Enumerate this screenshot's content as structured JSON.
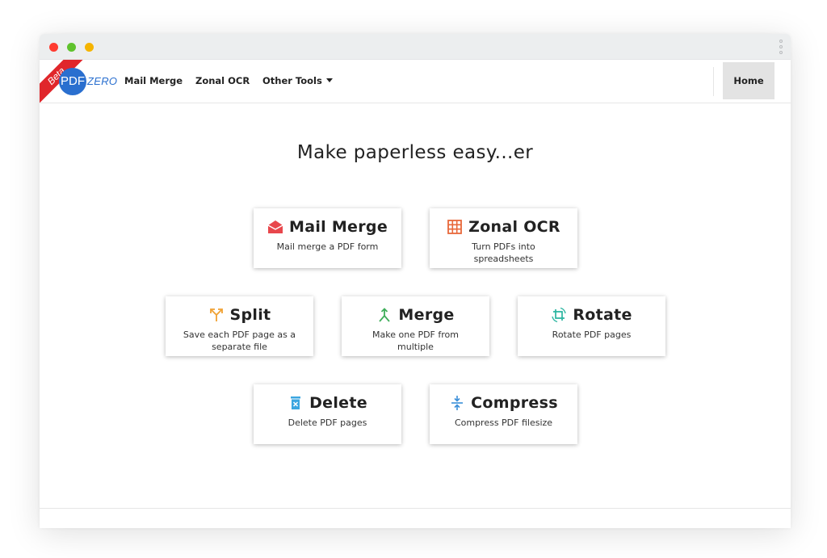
{
  "brand": {
    "beta_label": "Beta",
    "logo_mark": "PDF",
    "logo_text": "ZERO"
  },
  "nav": {
    "links": [
      "Mail Merge",
      "Zonal OCR",
      "Other Tools"
    ],
    "home": "Home"
  },
  "main": {
    "headline": "Make paperless easy...er",
    "tools": [
      {
        "title": "Mail Merge",
        "description": "Mail merge a PDF form",
        "icon": "envelope-open-icon",
        "color": "#e8474c"
      },
      {
        "title": "Zonal OCR",
        "description": "Turn PDFs into spreadsheets",
        "icon": "table-grid-icon",
        "color": "#e8683a"
      },
      {
        "title": "Split",
        "description": "Save each PDF page as a separate file",
        "icon": "split-arrows-icon",
        "color": "#f0a132"
      },
      {
        "title": "Merge",
        "description": "Make one PDF from multiple",
        "icon": "merge-arrows-icon",
        "color": "#3fae5a"
      },
      {
        "title": "Rotate",
        "description": "Rotate PDF pages",
        "icon": "rotate-crop-icon",
        "color": "#2bb5a0"
      },
      {
        "title": "Delete",
        "description": "Delete PDF pages",
        "icon": "trash-icon",
        "color": "#3ba6e0"
      },
      {
        "title": "Compress",
        "description": "Compress PDF filesize",
        "icon": "compress-vertical-icon",
        "color": "#3b8fd9"
      }
    ]
  }
}
